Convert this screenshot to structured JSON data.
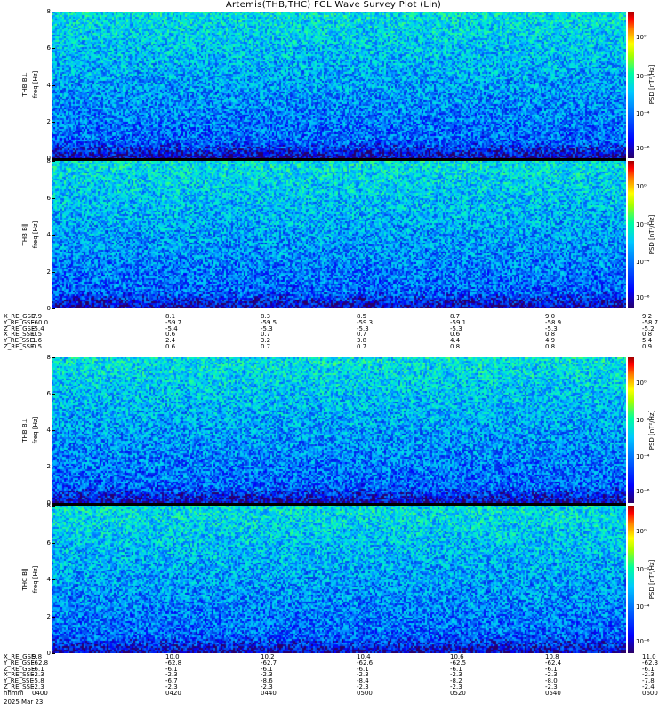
{
  "title": "Artemis(THB,THC) FGL Wave Survey Plot (Lin)",
  "colorbar": {
    "label": "PSD [nT²/Hz]",
    "ticks": [
      "10⁰",
      "10⁻²",
      "10⁻⁴",
      "10⁻⁶"
    ]
  },
  "freq_ticks": [
    "8",
    "6",
    "4",
    "2",
    "0"
  ],
  "panels": [
    {
      "probe": "THB B⊥",
      "freq_label": "freq [Hz]"
    },
    {
      "probe": "THB B∥",
      "freq_label": "freq [Hz]"
    },
    {
      "probe": "THB B⊥",
      "freq_label": "freq [Hz]"
    },
    {
      "probe": "THC B∥",
      "freq_label": "freq [Hz]"
    }
  ],
  "ephem_top": {
    "labels": [
      "X_RE_GSE",
      "Y_RE_GSE",
      "Z_RE_GSE",
      "X_RE_SSE",
      "Y_RE_SSE",
      "Z_RE_SSE"
    ],
    "rows": [
      [
        "7.9",
        "8.1",
        "8.3",
        "8.5",
        "8.7",
        "9.0",
        "9.2"
      ],
      [
        "-60.0",
        "-59.7",
        "-59.5",
        "-59.3",
        "-59.1",
        "-58.9",
        "-58.7"
      ],
      [
        "-5.4",
        "-5.4",
        "-5.3",
        "-5.3",
        "-5.3",
        "-5.3",
        "-5.2"
      ],
      [
        "0.5",
        "0.6",
        "0.7",
        "0.7",
        "0.6",
        "0.8",
        "0.8"
      ],
      [
        "1.6",
        "2.4",
        "3.2",
        "3.8",
        "4.4",
        "4.9",
        "5.4"
      ],
      [
        "0.5",
        "0.6",
        "0.7",
        "0.7",
        "0.8",
        "0.8",
        "0.9"
      ]
    ]
  },
  "ephem_bottom": {
    "labels": [
      "X_RE_GSE",
      "Y_RE_GSE",
      "Z_RE_GSE",
      "X_RE_SSE",
      "Y_RE_SSE",
      "Z_RE_SSE",
      "hhmm"
    ],
    "rows": [
      [
        "9.8",
        "10.0",
        "10.2",
        "10.4",
        "10.6",
        "10.8",
        "11.0"
      ],
      [
        "-62.8",
        "-62.8",
        "-62.7",
        "-62.6",
        "-62.5",
        "-62.4",
        "-62.3"
      ],
      [
        "-6.1",
        "-6.1",
        "-6.1",
        "-6.1",
        "-6.1",
        "-6.1",
        "-6.1"
      ],
      [
        "-2.3",
        "-2.3",
        "-2.3",
        "-2.3",
        "-2.3",
        "-2.3",
        "-2.3"
      ],
      [
        "-5.8",
        "-6.7",
        "-8.6",
        "-8.4",
        "-8.2",
        "-8.0",
        "-7.8"
      ],
      [
        "-2.3",
        "-2.3",
        "-2.3",
        "-2.3",
        "-2.3",
        "-2.3",
        "-2.4"
      ],
      [
        "0400",
        "0420",
        "0440",
        "0500",
        "0520",
        "0540",
        "0600"
      ]
    ]
  },
  "date": "2025 Mar 23",
  "chart_data": {
    "type": "heatmap",
    "title": "Artemis(THB,THC) FGL Wave Survey Plot (Lin)",
    "ylabel": "freq [Hz]",
    "ylim": [
      0,
      8
    ],
    "time_ticks": [
      "0400",
      "0420",
      "0440",
      "0500",
      "0520",
      "0540",
      "0600"
    ],
    "colorbar_label": "PSD [nT²/Hz]",
    "colorbar_ticks": [
      "10⁰",
      "10⁻²",
      "10⁻⁴",
      "10⁻⁶"
    ],
    "panels": [
      "THB B⊥",
      "THB B∥",
      "THB B⊥",
      "THC B∥"
    ],
    "colors": {
      "low": "#2a0066",
      "mid_low": "#0000ff",
      "mid": "#00c8ff",
      "mid_high": "#00ffa0",
      "high": "#ffff00",
      "max": "#a00000"
    }
  }
}
